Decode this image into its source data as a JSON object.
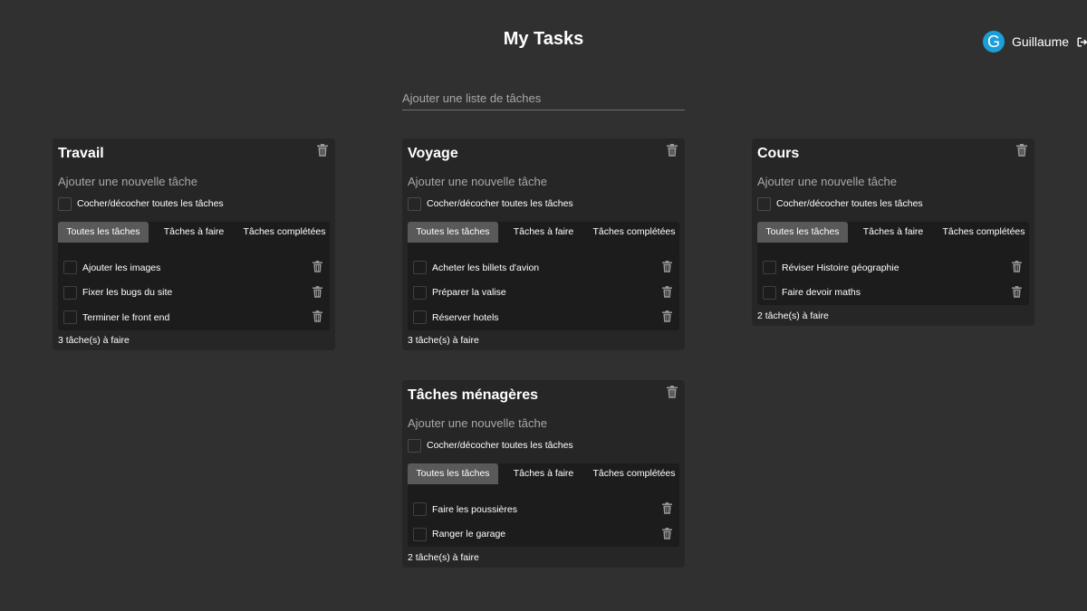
{
  "header": {
    "title": "My Tasks",
    "user": {
      "initial": "G",
      "name": "Guillaume",
      "avatar_color": "#1a9fd9"
    }
  },
  "add_list": {
    "placeholder": "Ajouter une liste de tâches"
  },
  "labels": {
    "new_task_placeholder": "Ajouter une nouvelle tâche",
    "check_all": "Cocher/décocher toutes les tâches",
    "tab_all": "Toutes les tâches",
    "tab_todo": "Tâches à faire",
    "tab_done": "Tâches complétées"
  },
  "lists": [
    {
      "title": "Travail",
      "tasks": [
        "Ajouter les images",
        "Fixer les bugs du site",
        "Terminer le front end"
      ],
      "count": "3 tâche(s) à faire"
    },
    {
      "title": "Voyage",
      "tasks": [
        "Acheter les billets d'avion",
        "Préparer la valise",
        "Réserver hotels"
      ],
      "count": "3 tâche(s) à faire"
    },
    {
      "title": "Cours",
      "tasks": [
        "Réviser Histoire géographie",
        "Faire devoir maths"
      ],
      "count": "2 tâche(s) à faire"
    },
    {
      "title": "Tâches ménagères",
      "tasks": [
        "Faire les poussières",
        "Ranger le garage"
      ],
      "count": "2 tâche(s) à faire"
    }
  ],
  "colors": {
    "background": "#303030",
    "card": "#262626",
    "panel": "#1c1c1c",
    "active_tab": "#595959",
    "accent": "#1a9fd9"
  }
}
